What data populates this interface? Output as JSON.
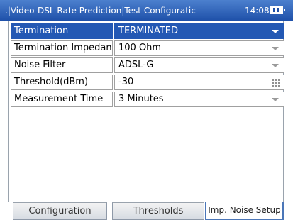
{
  "header": {
    "title": ".|Video-DSL Rate Prediction|Test Configuratic",
    "time": "14:08"
  },
  "settings": [
    {
      "label": "Termination",
      "value": "TERMINATED",
      "control": "dropdown"
    },
    {
      "label": "Termination Impedance",
      "value": "100 Ohm",
      "control": "dropdown"
    },
    {
      "label": "Noise Filter",
      "value": "ADSL-G",
      "control": "dropdown"
    },
    {
      "label": "Threshold(dBm)",
      "value": "-30",
      "control": "keypad"
    },
    {
      "label": "Measurement Time",
      "value": "3 Minutes",
      "control": "dropdown"
    }
  ],
  "tabs": [
    {
      "label": "Configuration",
      "active": false
    },
    {
      "label": "Thresholds",
      "active": false
    },
    {
      "label": "Imp. Noise Setup",
      "active": true
    }
  ],
  "colors": {
    "titlebar": "#2358b4",
    "selected_row": "#2358b4",
    "active_tab_border": "#4b76b8"
  }
}
